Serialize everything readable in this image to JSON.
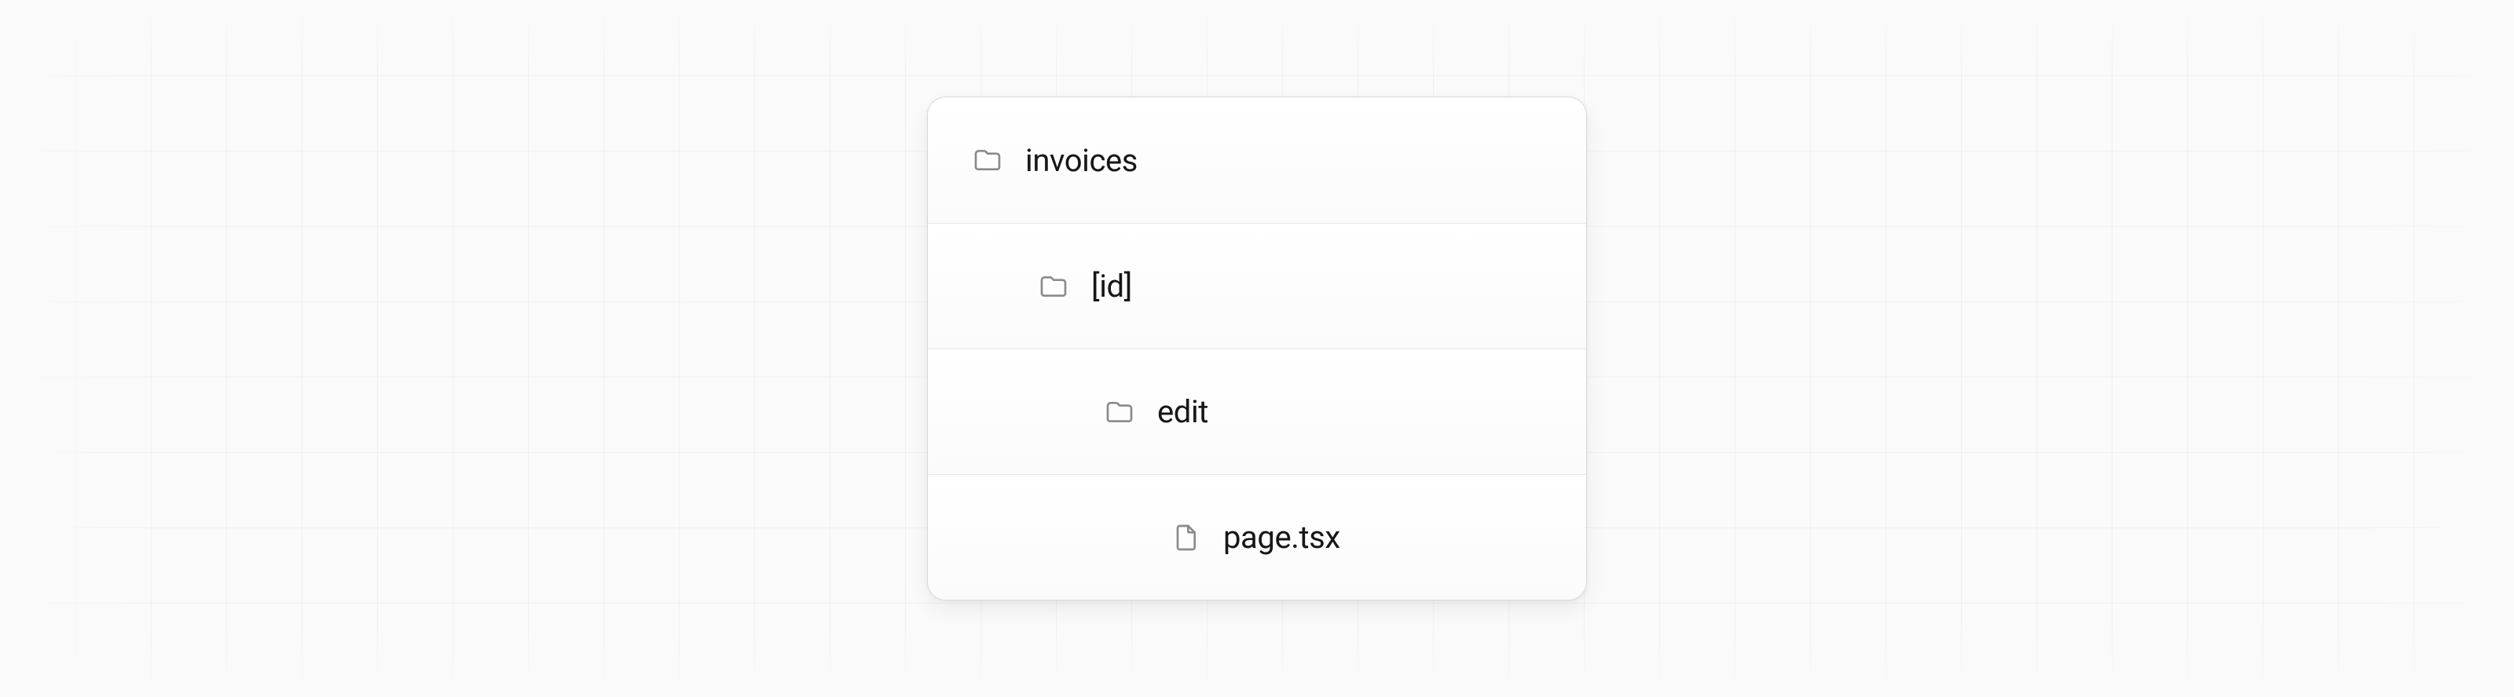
{
  "tree": {
    "items": [
      {
        "type": "folder",
        "label": "invoices",
        "depth": 0
      },
      {
        "type": "folder",
        "label": "[id]",
        "depth": 1
      },
      {
        "type": "folder",
        "label": "edit",
        "depth": 2
      },
      {
        "type": "file",
        "label": "page.tsx",
        "depth": 3
      }
    ]
  }
}
